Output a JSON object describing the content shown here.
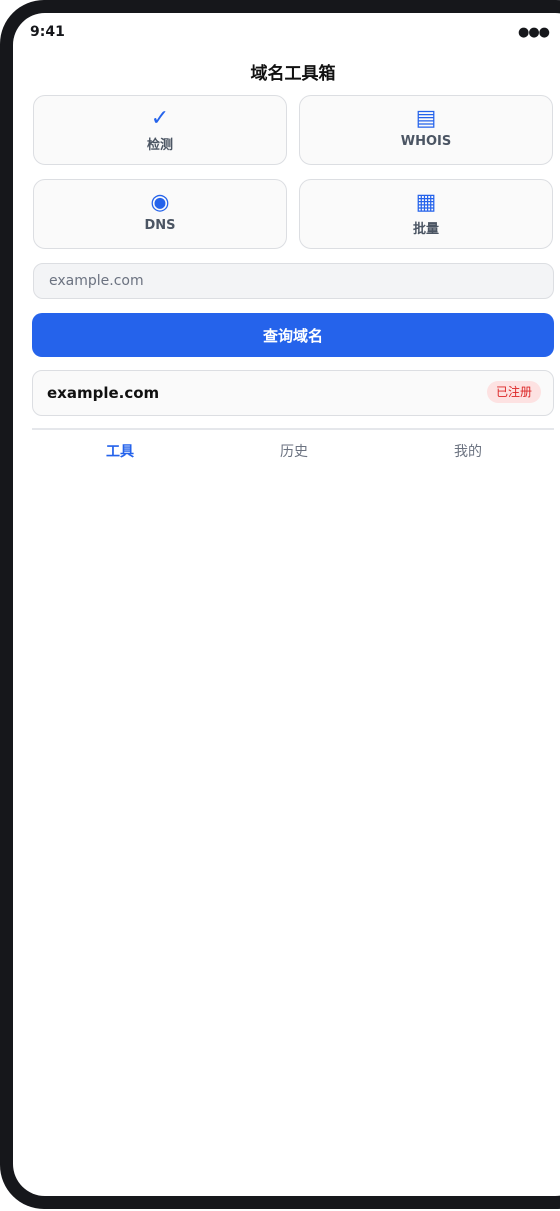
{
  "status_bar": {
    "time": "9:41",
    "indicator": "●●●"
  },
  "header": {
    "title": "域名工具箱"
  },
  "tools": [
    {
      "label": "检测",
      "icon": "✓",
      "icon_name": "check-icon"
    },
    {
      "label": "WHOIS",
      "icon": "▤",
      "icon_name": "document-icon"
    },
    {
      "label": "DNS",
      "icon": "◉",
      "icon_name": "dns-icon"
    },
    {
      "label": "批量",
      "icon": "▦",
      "icon_name": "grid-icon"
    }
  ],
  "search": {
    "placeholder": "example.com",
    "value": ""
  },
  "query_button": {
    "label": "查询域名"
  },
  "result": {
    "domain": "example.com",
    "status": "已注册"
  },
  "tab_bar": {
    "tabs": [
      {
        "label": "工具",
        "active": true
      },
      {
        "label": "历史",
        "active": false
      },
      {
        "label": "我的",
        "active": false
      }
    ]
  },
  "colors": {
    "accent": "#2563eb",
    "badge_bg": "#fde2e2",
    "badge_text": "#dc2626",
    "frame": "#16171b"
  }
}
